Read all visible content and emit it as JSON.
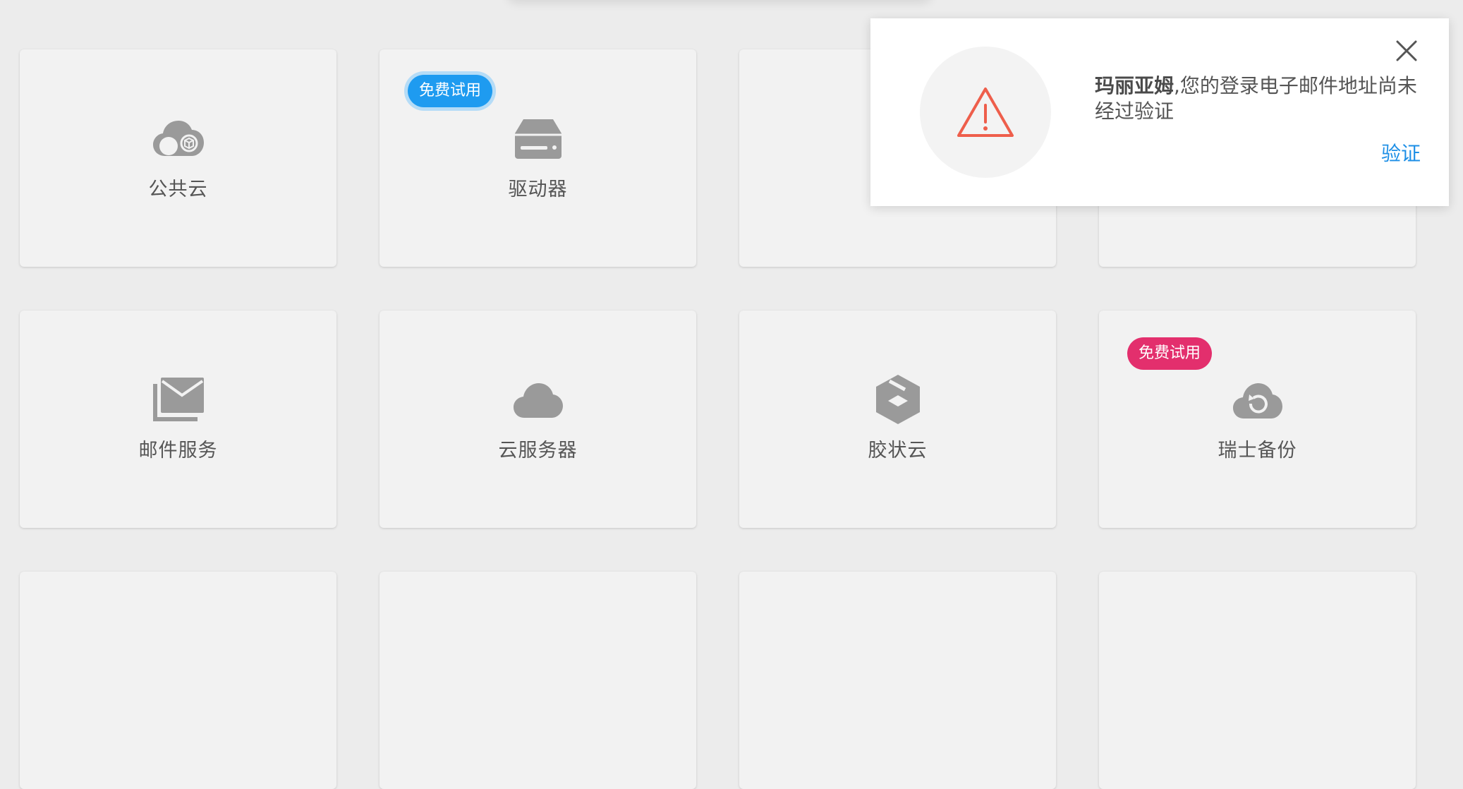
{
  "services": [
    {
      "label": "公共云",
      "icon": "cloud-box-icon"
    },
    {
      "label": "驱动器",
      "icon": "drive-icon",
      "badge": "免费试用",
      "badge_color": "#1e9bf0"
    },
    {
      "label": "",
      "icon": ""
    },
    {
      "label": "",
      "icon": ""
    },
    {
      "label": "邮件服务",
      "icon": "mail-icon"
    },
    {
      "label": "云服务器",
      "icon": "cloud-icon"
    },
    {
      "label": "胶状云",
      "icon": "jelastic-icon"
    },
    {
      "label": "瑞士备份",
      "icon": "cloud-backup-icon",
      "badge": "免费试用",
      "badge_color": "#e32f6d"
    }
  ],
  "notification": {
    "icon": "warning-icon",
    "name": "玛丽亚姆",
    "comma": ",",
    "message": "您的登录电子邮件地址尚未经过验证",
    "action": "验证",
    "close_icon": "close-icon"
  },
  "colors": {
    "background": "#ececec",
    "card": "#f2f2f2",
    "icon_gray": "#9a9a9a",
    "warning": "#ee5e4b",
    "link": "#1e8fe6"
  }
}
